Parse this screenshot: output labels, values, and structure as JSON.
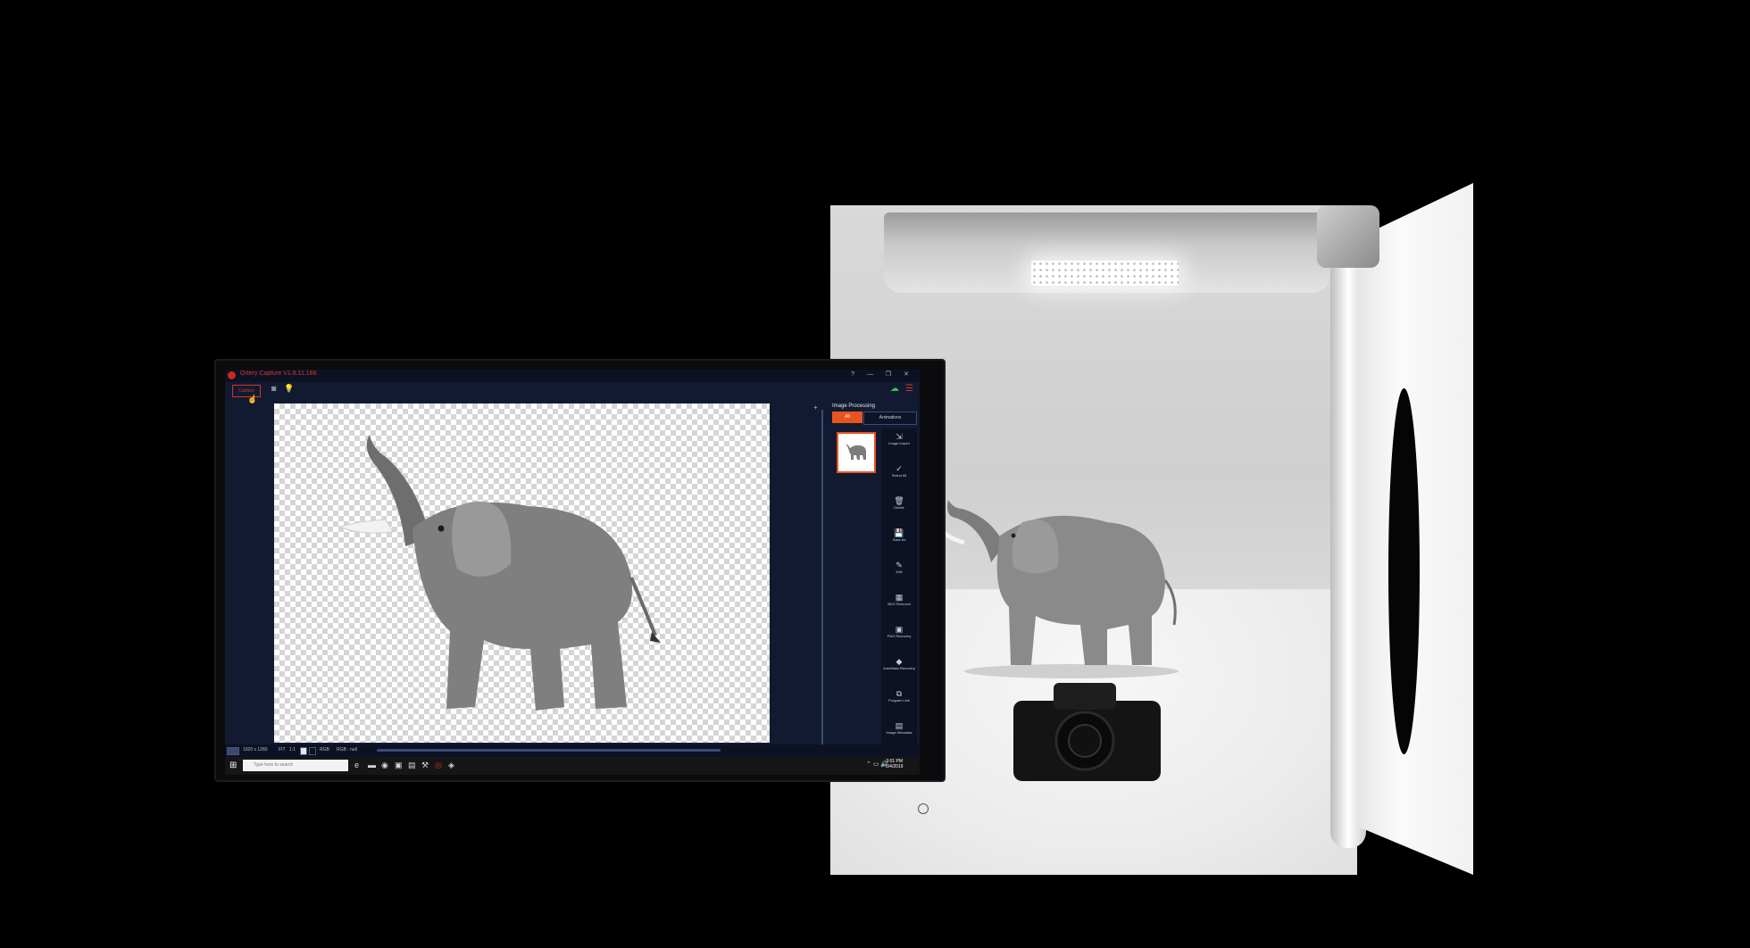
{
  "app": {
    "title": "Ortery Capture V1.8.11.188",
    "window_controls": "? — ❐ ✕",
    "capture_label": "Capture"
  },
  "panel": {
    "title": "Image Processing",
    "tabs": [
      {
        "label": "All"
      },
      {
        "label": "Animations"
      }
    ],
    "sidebar_items": [
      {
        "label": "Image Import",
        "icon": "import-icon",
        "glyph": "⇲"
      },
      {
        "label": "Select All",
        "icon": "select-all-icon",
        "glyph": "✓"
      },
      {
        "label": "Delete",
        "icon": "trash-icon",
        "glyph": "🗑"
      },
      {
        "label": "Save As",
        "icon": "save-icon",
        "glyph": "💾"
      },
      {
        "label": "Edit",
        "icon": "edit-icon",
        "glyph": "✎"
      },
      {
        "label": "BKG Removal",
        "icon": "bkg-removal-icon",
        "glyph": "▦"
      },
      {
        "label": "PNG Recovery",
        "icon": "png-recovery-icon",
        "glyph": "▣"
      },
      {
        "label": "AutoMask Recovery",
        "icon": "automask-icon",
        "glyph": "◆"
      },
      {
        "label": "Program Link",
        "icon": "link-icon",
        "glyph": "⧉"
      },
      {
        "label": "Image Metadata",
        "icon": "metadata-icon",
        "glyph": "▤"
      }
    ]
  },
  "status": {
    "dimensions": "1920 x 1280",
    "fit": "FIT",
    "ratio": "1:1",
    "color_mode": "RGB",
    "rgb_value": "RGB : null"
  },
  "taskbar": {
    "search_placeholder": "Type here to search",
    "time": "3:01 PM",
    "date": "6/4/2019"
  },
  "colors": {
    "accent": "#e8541f",
    "brand_red": "#d8351f",
    "app_background": "#111a30"
  }
}
